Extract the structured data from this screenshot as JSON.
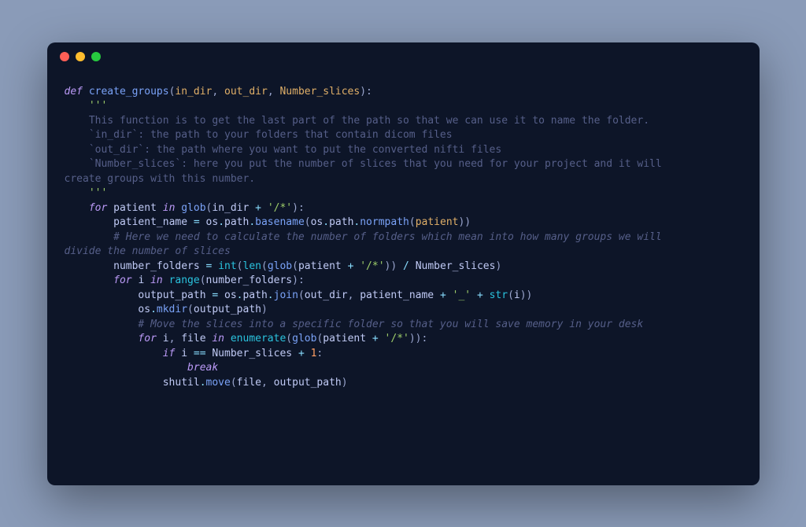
{
  "code": {
    "lines": [
      {
        "indent": 0,
        "segments": [
          {
            "cls": "kw",
            "text": "def"
          },
          {
            "cls": "",
            "text": " "
          },
          {
            "cls": "fn",
            "text": "create_groups"
          },
          {
            "cls": "paren",
            "text": "("
          },
          {
            "cls": "param",
            "text": "in_dir"
          },
          {
            "cls": "paren",
            "text": ", "
          },
          {
            "cls": "param",
            "text": "out_dir"
          },
          {
            "cls": "paren",
            "text": ", "
          },
          {
            "cls": "param",
            "text": "Number_slices"
          },
          {
            "cls": "paren",
            "text": "):"
          }
        ]
      },
      {
        "indent": 1,
        "segments": [
          {
            "cls": "str",
            "text": "'''"
          }
        ]
      },
      {
        "indent": 1,
        "segments": [
          {
            "cls": "docstr",
            "text": "This function is to get the last part of the path so that we can use it to name the folder."
          }
        ]
      },
      {
        "indent": 1,
        "segments": [
          {
            "cls": "docstr",
            "text": "`in_dir`: the path to your folders that contain dicom files"
          }
        ]
      },
      {
        "indent": 1,
        "segments": [
          {
            "cls": "docstr",
            "text": "`out_dir`: the path where you want to put the converted nifti files"
          }
        ]
      },
      {
        "indent": 1,
        "segments": [
          {
            "cls": "docstr",
            "text": "`Number_slices`: here you put the number of slices that you need for your project and it will "
          }
        ]
      },
      {
        "indent": 0,
        "segments": [
          {
            "cls": "docstr",
            "text": "create groups with this number."
          }
        ]
      },
      {
        "indent": 1,
        "segments": [
          {
            "cls": "str",
            "text": "'''"
          }
        ]
      },
      {
        "indent": 0,
        "segments": [
          {
            "cls": "",
            "text": ""
          }
        ]
      },
      {
        "indent": 1,
        "segments": [
          {
            "cls": "kw",
            "text": "for"
          },
          {
            "cls": "",
            "text": " "
          },
          {
            "cls": "var",
            "text": "patient"
          },
          {
            "cls": "",
            "text": " "
          },
          {
            "cls": "kw",
            "text": "in"
          },
          {
            "cls": "",
            "text": " "
          },
          {
            "cls": "call",
            "text": "glob"
          },
          {
            "cls": "paren",
            "text": "("
          },
          {
            "cls": "var",
            "text": "in_dir"
          },
          {
            "cls": "",
            "text": " "
          },
          {
            "cls": "op",
            "text": "+"
          },
          {
            "cls": "",
            "text": " "
          },
          {
            "cls": "str",
            "text": "'/*'"
          },
          {
            "cls": "paren",
            "text": "):"
          }
        ]
      },
      {
        "indent": 2,
        "segments": [
          {
            "cls": "var",
            "text": "patient_name"
          },
          {
            "cls": "",
            "text": " "
          },
          {
            "cls": "op",
            "text": "="
          },
          {
            "cls": "",
            "text": " "
          },
          {
            "cls": "var",
            "text": "os"
          },
          {
            "cls": "op",
            "text": "."
          },
          {
            "cls": "prop",
            "text": "path"
          },
          {
            "cls": "op",
            "text": "."
          },
          {
            "cls": "call",
            "text": "basename"
          },
          {
            "cls": "paren",
            "text": "("
          },
          {
            "cls": "var",
            "text": "os"
          },
          {
            "cls": "op",
            "text": "."
          },
          {
            "cls": "prop",
            "text": "path"
          },
          {
            "cls": "op",
            "text": "."
          },
          {
            "cls": "call",
            "text": "normpath"
          },
          {
            "cls": "paren",
            "text": "("
          },
          {
            "cls": "param",
            "text": "patient"
          },
          {
            "cls": "paren",
            "text": "))"
          }
        ]
      },
      {
        "indent": 0,
        "segments": [
          {
            "cls": "",
            "text": ""
          }
        ]
      },
      {
        "indent": 2,
        "segments": [
          {
            "cls": "comment",
            "text": "# Here we need to calculate the number of folders which mean into how many groups we will "
          }
        ]
      },
      {
        "indent": 0,
        "segments": [
          {
            "cls": "comment",
            "text": "divide the number of slices"
          }
        ]
      },
      {
        "indent": 2,
        "segments": [
          {
            "cls": "var",
            "text": "number_folders"
          },
          {
            "cls": "",
            "text": " "
          },
          {
            "cls": "op",
            "text": "="
          },
          {
            "cls": "",
            "text": " "
          },
          {
            "cls": "builtin",
            "text": "int"
          },
          {
            "cls": "paren",
            "text": "("
          },
          {
            "cls": "builtin",
            "text": "len"
          },
          {
            "cls": "paren",
            "text": "("
          },
          {
            "cls": "call",
            "text": "glob"
          },
          {
            "cls": "paren",
            "text": "("
          },
          {
            "cls": "var",
            "text": "patient"
          },
          {
            "cls": "",
            "text": " "
          },
          {
            "cls": "op",
            "text": "+"
          },
          {
            "cls": "",
            "text": " "
          },
          {
            "cls": "str",
            "text": "'/*'"
          },
          {
            "cls": "paren",
            "text": "))"
          },
          {
            "cls": "",
            "text": " "
          },
          {
            "cls": "op",
            "text": "/"
          },
          {
            "cls": "",
            "text": " "
          },
          {
            "cls": "var",
            "text": "Number_slices"
          },
          {
            "cls": "paren",
            "text": ")"
          }
        ]
      },
      {
        "indent": 0,
        "segments": [
          {
            "cls": "",
            "text": ""
          }
        ]
      },
      {
        "indent": 2,
        "segments": [
          {
            "cls": "kw",
            "text": "for"
          },
          {
            "cls": "",
            "text": " "
          },
          {
            "cls": "var",
            "text": "i"
          },
          {
            "cls": "",
            "text": " "
          },
          {
            "cls": "kw",
            "text": "in"
          },
          {
            "cls": "",
            "text": " "
          },
          {
            "cls": "builtin",
            "text": "range"
          },
          {
            "cls": "paren",
            "text": "("
          },
          {
            "cls": "var",
            "text": "number_folders"
          },
          {
            "cls": "paren",
            "text": "):"
          }
        ]
      },
      {
        "indent": 3,
        "segments": [
          {
            "cls": "var",
            "text": "output_path"
          },
          {
            "cls": "",
            "text": " "
          },
          {
            "cls": "op",
            "text": "="
          },
          {
            "cls": "",
            "text": " "
          },
          {
            "cls": "var",
            "text": "os"
          },
          {
            "cls": "op",
            "text": "."
          },
          {
            "cls": "prop",
            "text": "path"
          },
          {
            "cls": "op",
            "text": "."
          },
          {
            "cls": "call",
            "text": "join"
          },
          {
            "cls": "paren",
            "text": "("
          },
          {
            "cls": "var",
            "text": "out_dir"
          },
          {
            "cls": "paren",
            "text": ", "
          },
          {
            "cls": "var",
            "text": "patient_name"
          },
          {
            "cls": "",
            "text": " "
          },
          {
            "cls": "op",
            "text": "+"
          },
          {
            "cls": "",
            "text": " "
          },
          {
            "cls": "str",
            "text": "'_'"
          },
          {
            "cls": "",
            "text": " "
          },
          {
            "cls": "op",
            "text": "+"
          },
          {
            "cls": "",
            "text": " "
          },
          {
            "cls": "builtin",
            "text": "str"
          },
          {
            "cls": "paren",
            "text": "("
          },
          {
            "cls": "var",
            "text": "i"
          },
          {
            "cls": "paren",
            "text": "))"
          }
        ]
      },
      {
        "indent": 3,
        "segments": [
          {
            "cls": "var",
            "text": "os"
          },
          {
            "cls": "op",
            "text": "."
          },
          {
            "cls": "call",
            "text": "mkdir"
          },
          {
            "cls": "paren",
            "text": "("
          },
          {
            "cls": "var",
            "text": "output_path"
          },
          {
            "cls": "paren",
            "text": ")"
          }
        ]
      },
      {
        "indent": 0,
        "segments": [
          {
            "cls": "",
            "text": ""
          }
        ]
      },
      {
        "indent": 3,
        "segments": [
          {
            "cls": "comment",
            "text": "# Move the slices into a specific folder so that you will save memory in your desk"
          }
        ]
      },
      {
        "indent": 3,
        "segments": [
          {
            "cls": "kw",
            "text": "for"
          },
          {
            "cls": "",
            "text": " "
          },
          {
            "cls": "var",
            "text": "i"
          },
          {
            "cls": "paren",
            "text": ", "
          },
          {
            "cls": "var",
            "text": "file"
          },
          {
            "cls": "",
            "text": " "
          },
          {
            "cls": "kw",
            "text": "in"
          },
          {
            "cls": "",
            "text": " "
          },
          {
            "cls": "builtin",
            "text": "enumerate"
          },
          {
            "cls": "paren",
            "text": "("
          },
          {
            "cls": "call",
            "text": "glob"
          },
          {
            "cls": "paren",
            "text": "("
          },
          {
            "cls": "var",
            "text": "patient"
          },
          {
            "cls": "",
            "text": " "
          },
          {
            "cls": "op",
            "text": "+"
          },
          {
            "cls": "",
            "text": " "
          },
          {
            "cls": "str",
            "text": "'/*'"
          },
          {
            "cls": "paren",
            "text": ")):"
          }
        ]
      },
      {
        "indent": 4,
        "segments": [
          {
            "cls": "kw",
            "text": "if"
          },
          {
            "cls": "",
            "text": " "
          },
          {
            "cls": "var",
            "text": "i"
          },
          {
            "cls": "",
            "text": " "
          },
          {
            "cls": "op",
            "text": "=="
          },
          {
            "cls": "",
            "text": " "
          },
          {
            "cls": "var",
            "text": "Number_slices"
          },
          {
            "cls": "",
            "text": " "
          },
          {
            "cls": "op",
            "text": "+"
          },
          {
            "cls": "",
            "text": " "
          },
          {
            "cls": "num",
            "text": "1"
          },
          {
            "cls": "paren",
            "text": ":"
          }
        ]
      },
      {
        "indent": 5,
        "segments": [
          {
            "cls": "kw",
            "text": "break"
          }
        ]
      },
      {
        "indent": 0,
        "segments": [
          {
            "cls": "",
            "text": ""
          }
        ]
      },
      {
        "indent": 4,
        "segments": [
          {
            "cls": "var",
            "text": "shutil"
          },
          {
            "cls": "op",
            "text": "."
          },
          {
            "cls": "call",
            "text": "move"
          },
          {
            "cls": "paren",
            "text": "("
          },
          {
            "cls": "var",
            "text": "file"
          },
          {
            "cls": "paren",
            "text": ", "
          },
          {
            "cls": "var",
            "text": "output_path"
          },
          {
            "cls": "paren",
            "text": ")"
          }
        ]
      }
    ],
    "indentUnit": "    "
  }
}
